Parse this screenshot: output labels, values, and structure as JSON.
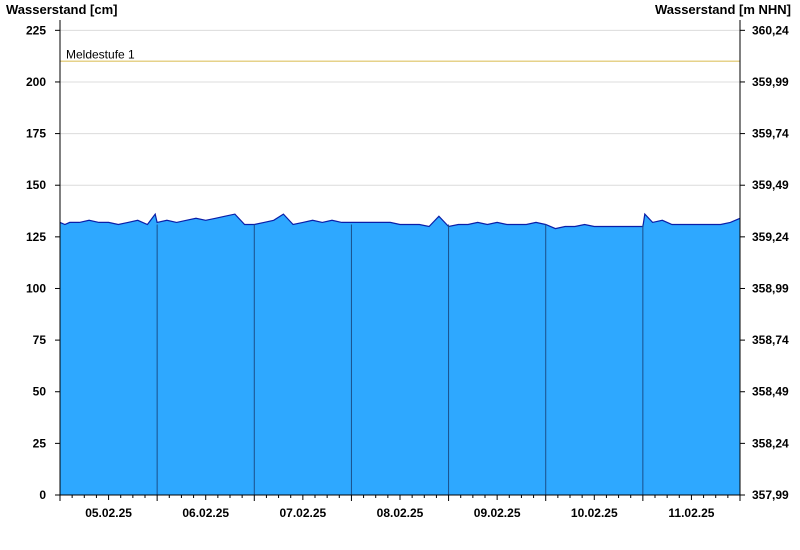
{
  "chart_data": {
    "type": "area",
    "ylabel_left": "Wasserstand [cm]",
    "ylabel_right": "Wasserstand [m NHN]",
    "ylim": [
      0,
      230
    ],
    "yticks_left": [
      0,
      25,
      50,
      75,
      100,
      125,
      150,
      175,
      200,
      225
    ],
    "yticks_right": [
      "357,99",
      "358,24",
      "358,49",
      "358,74",
      "358,99",
      "359,24",
      "359,49",
      "359,74",
      "359,99",
      "360,24"
    ],
    "x_tick_labels": [
      "05.02.25",
      "06.02.25",
      "07.02.25",
      "08.02.25",
      "09.02.25",
      "10.02.25",
      "11.02.25"
    ],
    "x_days": 7,
    "grid": true,
    "threshold": {
      "label": "Meldestufe 1",
      "value": 210,
      "color": "#e6d28a"
    },
    "colors": {
      "fill": "#2ea8ff",
      "line": "#0a1ea8",
      "grid": "#dcdcdc",
      "day_divider": "#1a4f8a"
    },
    "series": [
      {
        "x_day_offset": [
          0,
          0.05,
          0.1,
          0.2,
          0.3,
          0.4,
          0.5,
          0.6,
          0.7,
          0.8,
          0.9,
          0.98,
          1.0,
          1.1,
          1.2,
          1.3,
          1.4,
          1.5,
          1.6,
          1.7,
          1.8,
          1.9,
          2.0,
          2.1,
          2.2,
          2.3,
          2.4,
          2.5,
          2.6,
          2.7,
          2.8,
          2.9,
          3.0,
          3.1,
          3.2,
          3.3,
          3.4,
          3.5,
          3.6,
          3.7,
          3.8,
          3.9,
          4.0,
          4.1,
          4.2,
          4.3,
          4.4,
          4.5,
          4.6,
          4.7,
          4.8,
          4.9,
          5.0,
          5.1,
          5.2,
          5.3,
          5.4,
          5.5,
          5.6,
          5.7,
          5.8,
          5.9,
          6.0,
          6.02,
          6.1,
          6.2,
          6.3,
          6.4,
          6.5,
          6.6,
          6.7,
          6.8,
          6.9,
          7.0
        ],
        "y": [
          132,
          131,
          132,
          132,
          133,
          132,
          132,
          131,
          132,
          133,
          131,
          136,
          132,
          133,
          132,
          133,
          134,
          133,
          134,
          135,
          136,
          131,
          131,
          132,
          133,
          136,
          131,
          132,
          133,
          132,
          133,
          132,
          132,
          132,
          132,
          132,
          132,
          131,
          131,
          131,
          130,
          135,
          130,
          131,
          131,
          132,
          131,
          132,
          131,
          131,
          131,
          132,
          131,
          129,
          130,
          130,
          131,
          130,
          130,
          130,
          130,
          130,
          130,
          136,
          132,
          133,
          131,
          131,
          131,
          131,
          131,
          131,
          132,
          134
        ]
      }
    ]
  }
}
